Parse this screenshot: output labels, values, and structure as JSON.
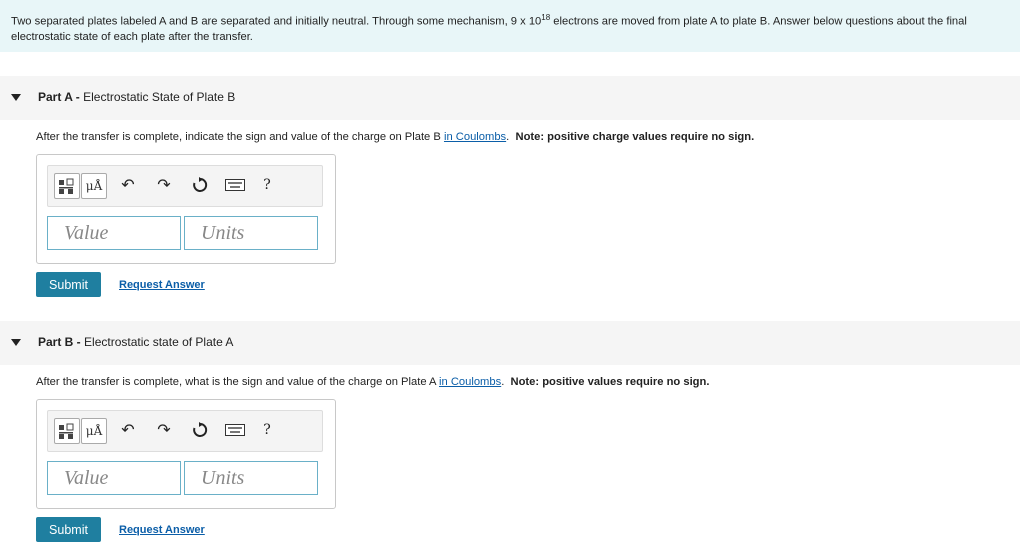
{
  "intro": {
    "text_before": "Two separated plates labeled A and B are separated and initially neutral. Through some mechanism, 9 x 10",
    "exponent": "18",
    "text_after": "electrons are moved from plate A to plate B. Answer below questions about the final electrostatic state of each plate after the transfer."
  },
  "parts": [
    {
      "label": "Part A -",
      "title": "Electrostatic State of Plate B",
      "question_prefix": "After the transfer is complete, indicate the sign and value of the charge on Plate B",
      "question_link": "in Coulombs",
      "question_suffix": ".",
      "note": "Note: positive charge values require no sign.",
      "toolbar": {
        "units_label": "μÅ",
        "help_label": "?"
      },
      "value_placeholder": "Value",
      "units_placeholder": "Units",
      "submit_label": "Submit",
      "request_label": "Request Answer"
    },
    {
      "label": "Part B -",
      "title": "Electrostatic state of Plate A",
      "question_prefix": "After the transfer is complete, what is the sign and value of the charge on Plate A",
      "question_link": "in Coulombs",
      "question_suffix": ".",
      "note": "Note: positive values require no sign.",
      "toolbar": {
        "units_label": "μÅ",
        "help_label": "?"
      },
      "value_placeholder": "Value",
      "units_placeholder": "Units",
      "submit_label": "Submit",
      "request_label": "Request Answer"
    }
  ],
  "colors": {
    "intro_bg": "#e8f6f8",
    "submit_bg": "#1f7fa0",
    "link": "#0b5ea8"
  }
}
